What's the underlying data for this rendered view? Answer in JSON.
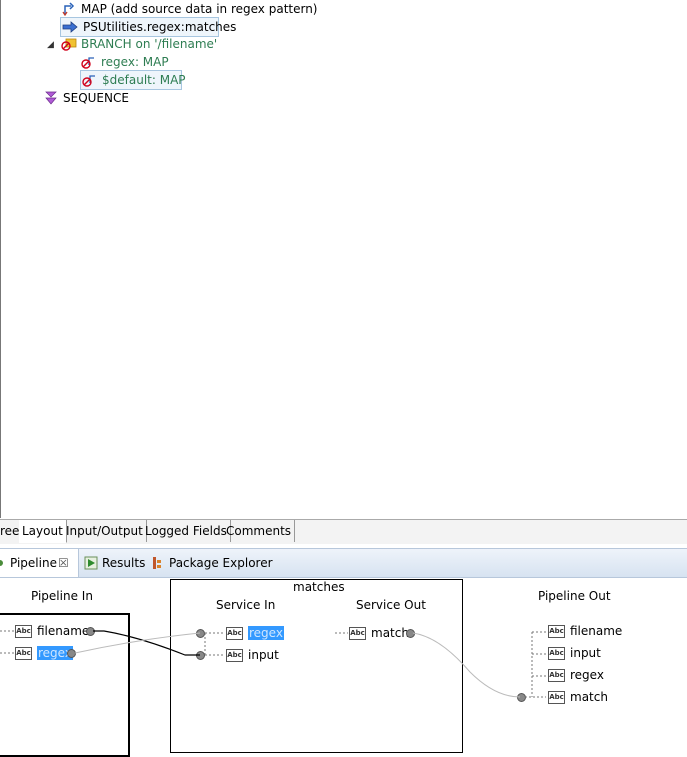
{
  "tree": {
    "items": [
      {
        "label": "MAP (add source data in regex pattern)"
      },
      {
        "label": "PSUtilities.regex:matches"
      },
      {
        "label": "BRANCH on '/filename'"
      },
      {
        "label": "regex: MAP"
      },
      {
        "label": "$default: MAP"
      },
      {
        "label": "SEQUENCE"
      }
    ]
  },
  "editor_tabs": [
    "ree",
    "Layout",
    "Input/Output",
    "Logged Fields",
    "Comments"
  ],
  "view_tabs": {
    "pipeline": "Pipeline",
    "close": "☒",
    "results": "Results",
    "package_explorer": "Package Explorer"
  },
  "pipeline": {
    "in_title": "Pipeline In",
    "service_title": "matches",
    "service_in_title": "Service In",
    "service_out_title": "Service Out",
    "out_title": "Pipeline Out",
    "abc_text": "Abc",
    "in_vars": [
      "filename",
      "regex"
    ],
    "service_in_vars": [
      "regex",
      "input"
    ],
    "service_out_vars": [
      "match"
    ],
    "out_vars": [
      "filename",
      "input",
      "regex",
      "match"
    ]
  }
}
